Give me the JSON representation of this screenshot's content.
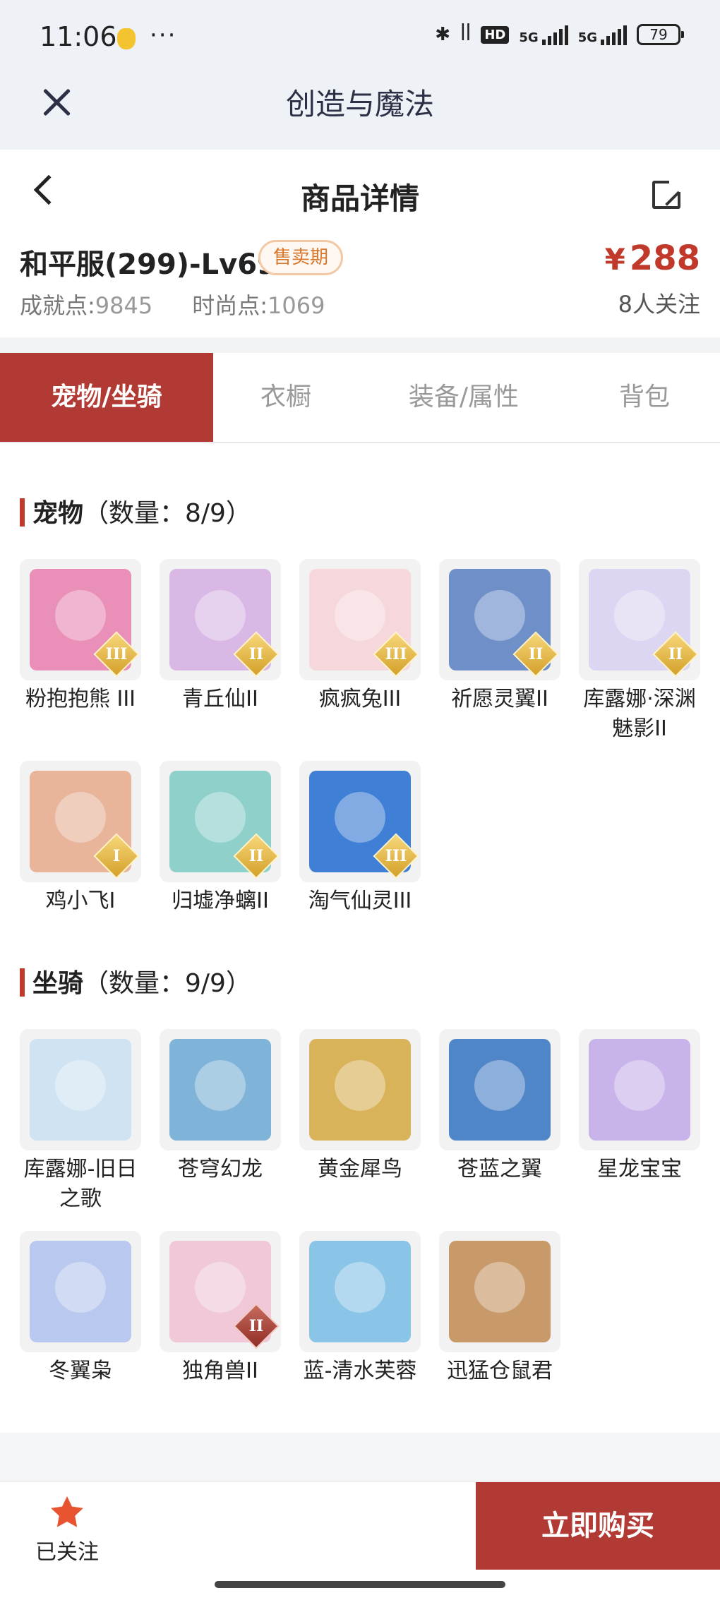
{
  "status_bar": {
    "time": "11:06",
    "dots": "···",
    "hd": "HD",
    "sim1": "5G",
    "sim2": "5G",
    "battery": "79"
  },
  "app": {
    "title": "创造与魔法"
  },
  "nav": {
    "title": "商品详情"
  },
  "product": {
    "name": "和平服(299)-Lv69",
    "badge": "售卖期",
    "achievement_label": "成就点:",
    "achievement_value": "9845",
    "fashion_label": "时尚点:",
    "fashion_value": "1069",
    "price_symbol": "¥",
    "price": "288",
    "followers": "8人关注"
  },
  "tabs": [
    {
      "label": "宠物/坐骑",
      "active": true
    },
    {
      "label": "衣橱",
      "active": false
    },
    {
      "label": "装备/属性",
      "active": false
    },
    {
      "label": "背包",
      "active": false
    }
  ],
  "pets": {
    "title_main": "宠物",
    "title_count": "（数量：8/9）",
    "items": [
      {
        "name": "粉抱抱熊 III",
        "tier": "III",
        "color": "#e98fb8"
      },
      {
        "name": "青丘仙II",
        "tier": "II",
        "color": "#d9b8e6"
      },
      {
        "name": "疯疯兔III",
        "tier": "III",
        "color": "#f6d7dc"
      },
      {
        "name": "祈愿灵翼II",
        "tier": "II",
        "color": "#6f8fc9"
      },
      {
        "name": "库露娜·深渊魅影II",
        "tier": "II",
        "color": "#dcd6f2"
      },
      {
        "name": "鸡小飞I",
        "tier": "I",
        "color": "#e8b49a"
      },
      {
        "name": "归墟净螭II",
        "tier": "II",
        "color": "#8fd0cb"
      },
      {
        "name": "淘气仙灵III",
        "tier": "III",
        "color": "#3f7fd6"
      }
    ]
  },
  "mounts": {
    "title_main": "坐骑",
    "title_count": "（数量：9/9）",
    "items": [
      {
        "name": "库露娜-旧日之歌",
        "tier": "",
        "color": "#cfe3f2"
      },
      {
        "name": "苍穹幻龙",
        "tier": "",
        "color": "#7fb4d8"
      },
      {
        "name": "黄金犀鸟",
        "tier": "",
        "color": "#d9b35a"
      },
      {
        "name": "苍蓝之翼",
        "tier": "",
        "color": "#4f86c8"
      },
      {
        "name": "星龙宝宝",
        "tier": "",
        "color": "#c8b4ea"
      },
      {
        "name": "冬翼枭",
        "tier": "",
        "color": "#b9c8ee"
      },
      {
        "name": "独角兽II",
        "tier": "II",
        "color": "#f0c8d8"
      },
      {
        "name": "蓝-清水芙蓉",
        "tier": "",
        "color": "#8ac4e6"
      },
      {
        "name": "迅猛仓鼠君",
        "tier": "",
        "color": "#c89a6a"
      }
    ]
  },
  "bottom": {
    "follow_label": "已关注",
    "buy_label": "立即购买"
  },
  "colors": {
    "accent": "#b23a34",
    "price": "#c0392b",
    "star": "#e8542f"
  }
}
